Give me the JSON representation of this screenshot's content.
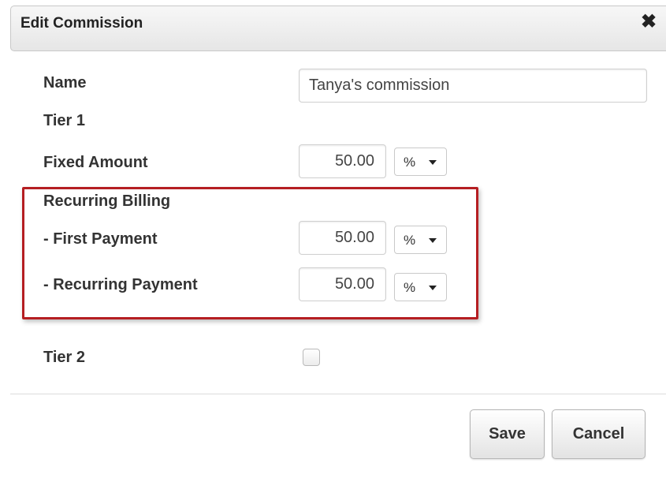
{
  "dialog": {
    "title": "Edit Commission",
    "close_icon": "close-icon",
    "close_glyph": "✖"
  },
  "form": {
    "name_label": "Name",
    "name_value": "Tanya's commission",
    "tier1_label": "Tier 1",
    "fixed_amount_label": "Fixed Amount",
    "fixed_amount_value": "50.00",
    "fixed_amount_unit": "%",
    "recurring_billing_label": "Recurring Billing",
    "first_payment_label": "- First Payment",
    "first_payment_value": "50.00",
    "first_payment_unit": "%",
    "recurring_payment_label": "- Recurring Payment",
    "recurring_payment_value": "50.00",
    "recurring_payment_unit": "%",
    "tier2_label": "Tier 2",
    "tier2_checked": false
  },
  "footer": {
    "save_label": "Save",
    "cancel_label": "Cancel"
  },
  "colors": {
    "highlight": "#b51e22"
  }
}
